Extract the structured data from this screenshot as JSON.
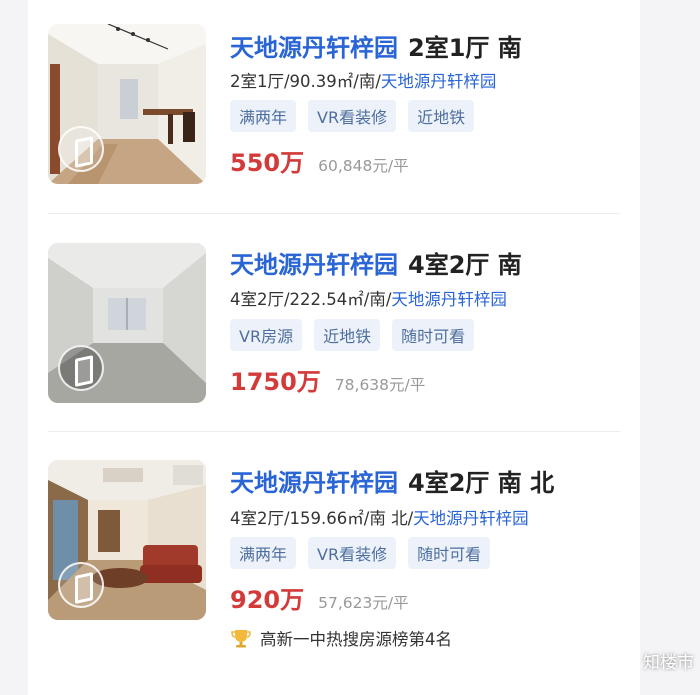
{
  "listings": [
    {
      "estate": "天地源丹轩梓园",
      "layout": "2室1厅 南",
      "meta_prefix": "2室1厅/90.39㎡/南/",
      "meta_estate": "天地源丹轩梓园",
      "tags": [
        "满两年",
        "VR看装修",
        "近地铁"
      ],
      "total_price": "550万",
      "unit_price": "60,848元/平"
    },
    {
      "estate": "天地源丹轩梓园",
      "layout": "4室2厅 南",
      "meta_prefix": "4室2厅/222.54㎡/南/",
      "meta_estate": "天地源丹轩梓园",
      "tags": [
        "VR房源",
        "近地铁",
        "随时可看"
      ],
      "total_price": "1750万",
      "unit_price": "78,638元/平"
    },
    {
      "estate": "天地源丹轩梓园",
      "layout": "4室2厅 南 北",
      "meta_prefix": "4室2厅/159.66㎡/南 北/",
      "meta_estate": "天地源丹轩梓园",
      "tags": [
        "满两年",
        "VR看装修",
        "随时可看"
      ],
      "total_price": "920万",
      "unit_price": "57,623元/平",
      "rank": "高新一中热搜房源榜第4名"
    }
  ],
  "watermark": "知楼市",
  "icons": {
    "vr": "vr-cube-icon",
    "trophy": "trophy-icon",
    "watermark": "wechat-icon"
  },
  "colors": {
    "estate_blue": "#2a65d6",
    "price_red": "#d33b3b",
    "tag_bg": "#edf2fa",
    "tag_text": "#4e6f9e"
  }
}
